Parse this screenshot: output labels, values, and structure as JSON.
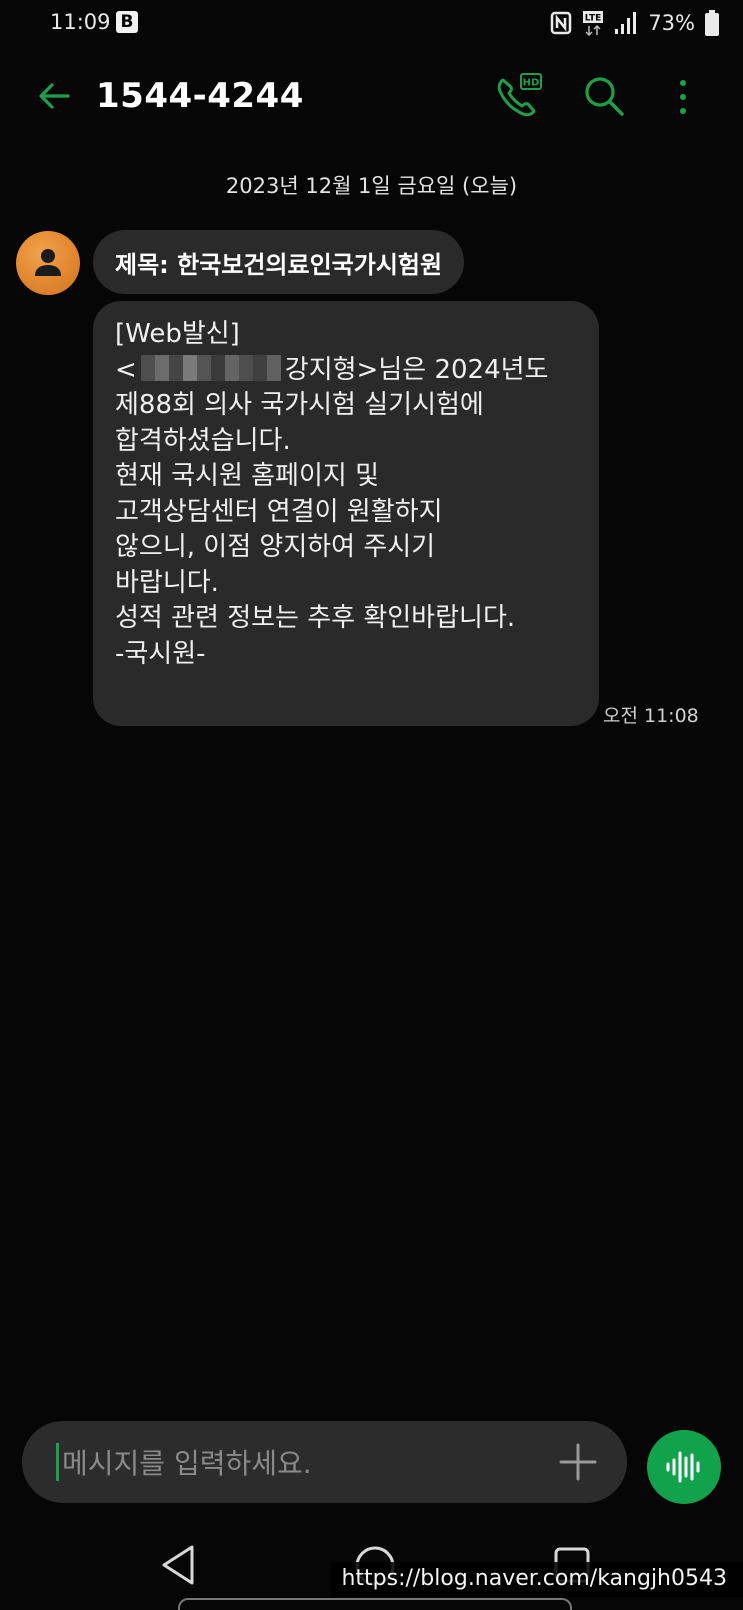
{
  "status_bar": {
    "time": "11:09",
    "app_badge": "B",
    "network": "LTE",
    "battery": "73%"
  },
  "header": {
    "title": "1544-4244",
    "hd_label": "HD",
    "accent_color": "#1ea04a"
  },
  "conversation": {
    "date_separator": "2023년 12월 1일 금요일 (오늘)",
    "subject": "제목: 한국보건의료인국가시험원",
    "message": {
      "lines": [
        "[Web발신]",
        "<",
        "제88회 의사 국가시험 실기시험에",
        "합격하셨습니다.",
        "현재 국시원 홈페이지 및",
        "고객상담센터 연결이 원활하지",
        "않으니, 이점 양지하여 주시기",
        "바랍니다.",
        "성적 관련 정보는 추후 확인바랍니다.",
        "-국시원-"
      ],
      "line2_suffix": "강지형>님은 2024년도",
      "time": "오전 11:08"
    }
  },
  "composer": {
    "placeholder": "메시지를 입력하세요."
  },
  "watermark": "https://blog.naver.com/kangjh0543"
}
